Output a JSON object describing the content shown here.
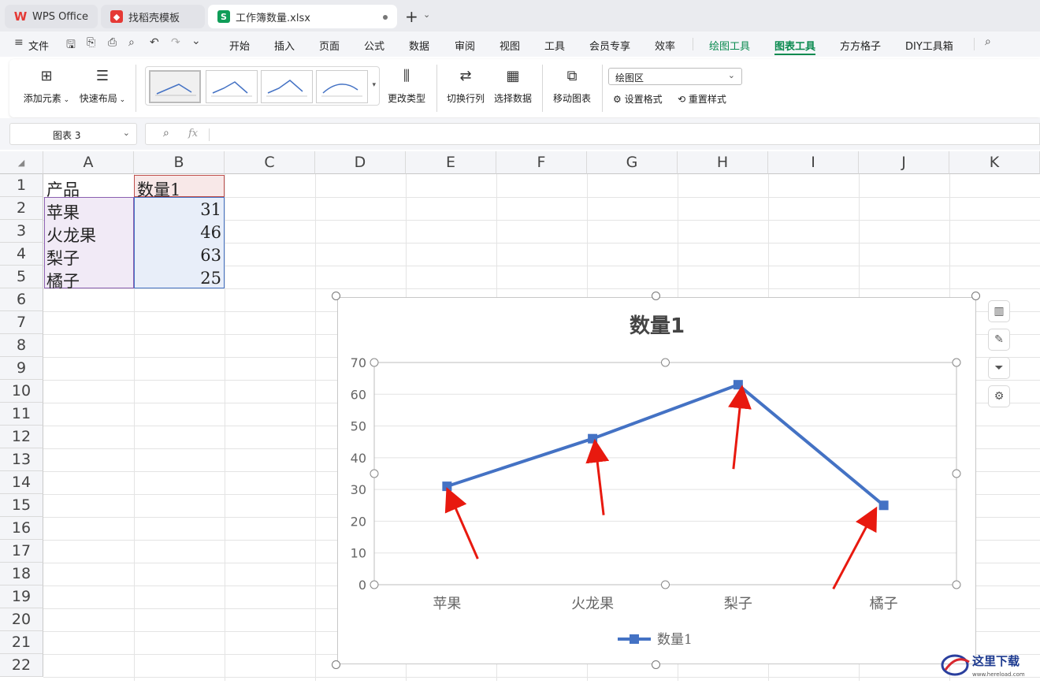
{
  "tabs": [
    {
      "label": "WPS Office",
      "icon": "wps-logo-icon"
    },
    {
      "label": "找稻壳模板",
      "icon": "docer-icon"
    },
    {
      "label": "工作簿数量.xlsx",
      "icon": "spreadsheet-s-icon",
      "icon_letter": "S",
      "active": true
    }
  ],
  "new_tab": "+",
  "menu": {
    "file": "文件",
    "items": [
      "开始",
      "插入",
      "页面",
      "公式",
      "数据",
      "审阅",
      "视图",
      "工具",
      "会员专享",
      "效率",
      "绘图工具",
      "图表工具",
      "方方格子",
      "DIY工具箱"
    ],
    "active": "图表工具"
  },
  "ribbon": {
    "add_element": "添加元素",
    "quick_layout": "快速布局",
    "change_type": "更改类型",
    "switch_rowcol": "切换行列",
    "select_data": "选择数据",
    "move_chart": "移动图表",
    "area_select": "绘图区",
    "set_format": "设置格式",
    "reset_style": "重置样式"
  },
  "namebox": "图表 3",
  "fx": "fx",
  "columns": [
    "A",
    "B",
    "C",
    "D",
    "E",
    "F",
    "G",
    "H",
    "I",
    "J",
    "K"
  ],
  "rows": [
    "1",
    "2",
    "3",
    "4",
    "5",
    "6",
    "7",
    "8",
    "9",
    "10",
    "11",
    "12",
    "13",
    "14",
    "15",
    "16",
    "17",
    "18",
    "19",
    "20",
    "21",
    "22"
  ],
  "cells": {
    "A1": "产品",
    "B1": "数量1",
    "A2": "苹果",
    "B2": "31",
    "A3": "火龙果",
    "B3": "46",
    "A4": "梨子",
    "B4": "63",
    "A5": "橘子",
    "B5": "25"
  },
  "colors": {
    "accent": "#0a8a4f",
    "series": "#4472c4",
    "arrow": "#e8190f"
  },
  "chart_data": {
    "type": "line",
    "title": "数量1",
    "categories": [
      "苹果",
      "火龙果",
      "梨子",
      "橘子"
    ],
    "series": [
      {
        "name": "数量1",
        "values": [
          31,
          46,
          63,
          25
        ]
      }
    ],
    "ylim": [
      0,
      70
    ],
    "yticks": [
      "0",
      "10",
      "20",
      "30",
      "40",
      "50",
      "60",
      "70"
    ],
    "grid": true,
    "legend": "bottom"
  },
  "watermark": {
    "text": "这里下载",
    "sub": "www.hereload.com"
  }
}
